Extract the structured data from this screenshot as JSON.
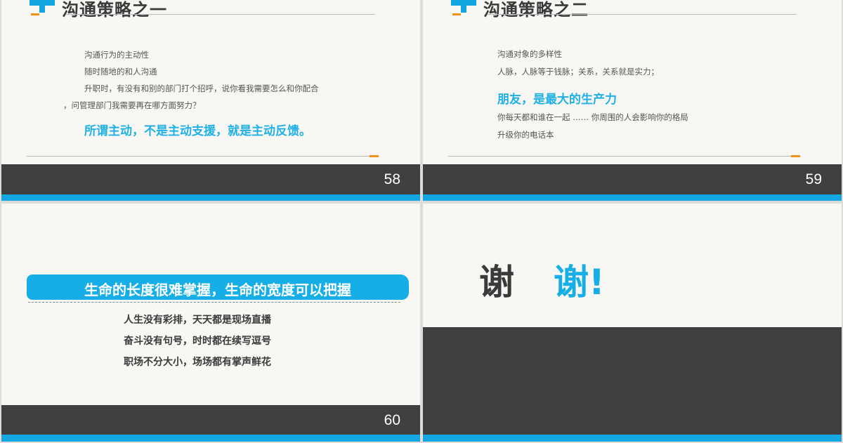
{
  "slides": [
    {
      "number": "58",
      "title": "沟通策略之一",
      "lines": [
        "沟通行为的主动性",
        "随时随地的和人沟通",
        "升职时，有没有和别的部门打个招呼，说你看我需要怎么和你配合",
        "，问管理部门我需要再在哪方面努力？"
      ],
      "highlight": "所谓主动，不是主动支援，就是主动反馈。"
    },
    {
      "number": "59",
      "title": "沟通策略之二",
      "lines": [
        "沟通对象的多样性",
        "人脉，人脉等于钱脉；关系，关系就是实力；"
      ],
      "highlight": "朋友，是最大的生产力",
      "lines_after": [
        "你每天都和谁在一起 …… 你周围的人会影响你的格局",
        "升级你的电话本"
      ]
    },
    {
      "number": "60",
      "banner": "生命的长度很难掌握，生命的宽度可以把握",
      "quotes": [
        "人生没有彩排，天天都是现场直播",
        "奋斗没有句号，时时都在续写逗号",
        "职场不分大小，场场都有掌声鲜花"
      ]
    },
    {
      "thanks_first": "谢",
      "thanks_second": "谢!"
    }
  ],
  "colors": {
    "accent_blue": "#12a7e3",
    "accent_orange": "#f0931b",
    "footer_dark": "#404040",
    "slide_bg": "#f8f7f3"
  }
}
